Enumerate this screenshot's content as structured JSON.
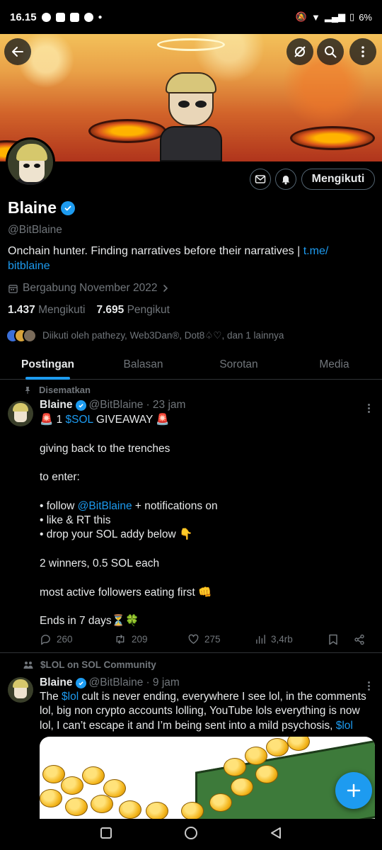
{
  "status_bar": {
    "time": "16.15",
    "battery": "6%"
  },
  "profile": {
    "name": "Blaine",
    "handle": "@BitBlaine",
    "bio_text": "Onchain hunter. Finding narratives before their narratives | ",
    "bio_link_line1": "t.me/",
    "bio_link_line2": "bitblaine",
    "joined": "Bergabung November 2022",
    "following_count": "1.437",
    "following_label": "Mengikuti",
    "followers_count": "7.695",
    "followers_label": "Pengikut",
    "followed_by": "Diikuti oleh pathezy, Web3Dan®, Dot8♤♡, dan 1 lainnya",
    "follow_button": "Mengikuti"
  },
  "tabs": [
    {
      "label": "Postingan"
    },
    {
      "label": "Balasan"
    },
    {
      "label": "Sorotan"
    },
    {
      "label": "Media"
    }
  ],
  "post1": {
    "context": "Disematkan",
    "name": "Blaine",
    "handle": "@BitBlaine",
    "time": "· 23 jam",
    "line1_pre": "🚨 1 ",
    "line1_tag": "$SOL",
    "line1_post": " GIVEAWAY 🚨",
    "line2": "giving back to the trenches",
    "line3": "to enter:",
    "line4_pre": "• follow ",
    "line4_mention": "@BitBlaine",
    "line4_post": " + notifications on",
    "line5": "• like & RT this",
    "line6": "• drop your SOL addy below 👇",
    "line7": "2 winners, 0.5 SOL each",
    "line8": "most active followers eating first 👊",
    "line9": "Ends in 7 days⏳🍀",
    "replies": "260",
    "reposts": "209",
    "likes": "275",
    "views": "3,4rb"
  },
  "post2": {
    "context": "$LOL on SOL Community",
    "name": "Blaine",
    "handle": "@BitBlaine",
    "time": "· 9 jam",
    "text_pre": "The ",
    "tag1": "$lol",
    "text_mid": " cult is never ending, everywhere I see lol, in the comments lol, big non crypto accounts lolling, YouTube lols everything is now lol, I can’t escape it and I’m being sent into a mild psychosis, ",
    "tag2": "$lol"
  },
  "colors": {
    "accent": "#1d9bf0",
    "muted": "#71767b",
    "text": "#e7e9ea",
    "background": "#000000"
  }
}
